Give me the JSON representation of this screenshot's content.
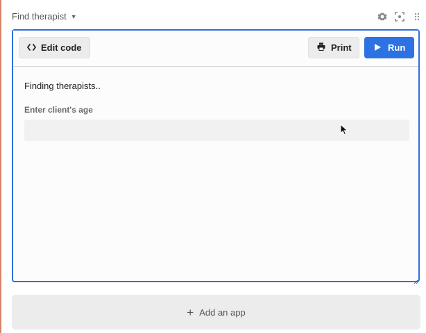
{
  "app": {
    "title": "Find therapist",
    "header_icons": [
      "gear-icon",
      "focus-icon",
      "drag-handle-icon"
    ]
  },
  "toolbar": {
    "edit_label": "Edit code",
    "print_label": "Print",
    "run_label": "Run"
  },
  "main": {
    "status_text": "Finding therapists..",
    "field_label": "Enter client's age",
    "age_value": ""
  },
  "footer": {
    "add_app_label": "Add an app"
  },
  "colors": {
    "accent": "#2d72e3",
    "frame_border": "#2f6fdc"
  }
}
